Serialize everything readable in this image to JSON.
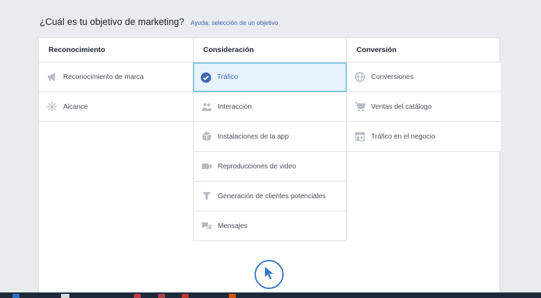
{
  "header": {
    "question": "¿Cuál es tu objetivo de marketing?",
    "help_link": "Ayuda: selección de un objetivo"
  },
  "columns": [
    {
      "title": "Reconocimiento",
      "items": [
        {
          "label": "Reconocimiento de marca",
          "icon": "megaphone-icon"
        },
        {
          "label": "Alcance",
          "icon": "reach-icon"
        }
      ]
    },
    {
      "title": "Consideración",
      "items": [
        {
          "label": "Tráfico",
          "icon": "check-circle-icon",
          "selected": true
        },
        {
          "label": "Interacción",
          "icon": "people-icon"
        },
        {
          "label": "Instalaciones de la app",
          "icon": "box-icon"
        },
        {
          "label": "Reproducciones de video",
          "icon": "video-camera-icon"
        },
        {
          "label": "Generación de clientes potenciales",
          "icon": "funnel-icon"
        },
        {
          "label": "Mensajes",
          "icon": "chat-bubbles-icon"
        }
      ]
    },
    {
      "title": "Conversión",
      "items": [
        {
          "label": "Conversiones",
          "icon": "globe-icon"
        },
        {
          "label": "Ventas del catálogo",
          "icon": "shopping-cart-icon"
        },
        {
          "label": "Tráfico en el negocio",
          "icon": "storefront-icon"
        }
      ]
    }
  ],
  "colors": {
    "accent": "#4267b2",
    "selected_bg": "#e7f3ff",
    "selected_border": "#83c5e0",
    "icon_gray": "#b6bbc4",
    "cursor_blue": "#3578c6"
  },
  "overlay": {
    "icon": "cursor-arrow-icon"
  }
}
